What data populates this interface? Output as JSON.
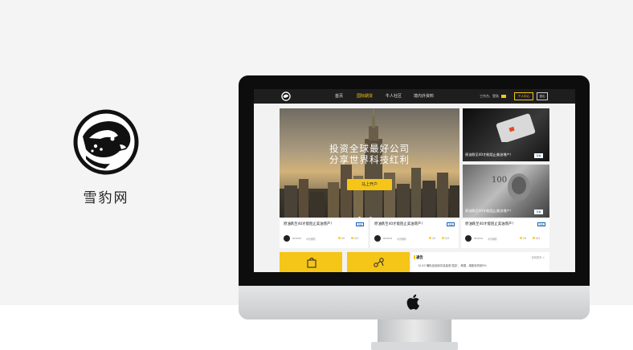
{
  "brand": {
    "name": "雪豹网",
    "logo_icon": "snow-leopard-icon"
  },
  "site": {
    "nav": {
      "items": [
        "首页",
        "国际期货",
        "牛人社区",
        "境内外资料"
      ],
      "active_index": 1,
      "login": "工作台、登陆",
      "account_button": "个人中心",
      "lang_button": "退出"
    },
    "hero": {
      "title": "投资全球最好公司",
      "subtitle": "分享世界科技红利",
      "button": "马上开户",
      "slides": 2,
      "active_slide": 1
    },
    "side_cards": [
      {
        "title": "原油跌至40才能阻止美油增产！",
        "tag": "查看"
      },
      {
        "title": "原油跌至40才能阻止美油增产！",
        "tag": "查看"
      }
    ],
    "news": [
      {
        "title": "原油跌至40才能阻止美油增产！",
        "tag": "查看",
        "author": "Anoma",
        "time": "4分钟前",
        "likes": "20",
        "comments": "0/3"
      },
      {
        "title": "原油跌至40才能阻止美油增产！",
        "tag": "查看",
        "author": "Anoma",
        "time": "4分钟前",
        "likes": "20",
        "comments": "0/3"
      },
      {
        "title": "原油跌至40才能阻止美油增产！",
        "tag": "查看",
        "author": "Anoma",
        "time": "4分钟前",
        "likes": "20",
        "comments": "0/3"
      }
    ],
    "notice": {
      "title": "通告",
      "more": "查看更多 >",
      "text": "12.43 横批品品库存高量涨'强劲'，美国，增能较低倒5%"
    },
    "colors": {
      "accent": "#f5c518",
      "nav_bg": "#1e1e1e",
      "link": "#1a5fb4"
    }
  }
}
